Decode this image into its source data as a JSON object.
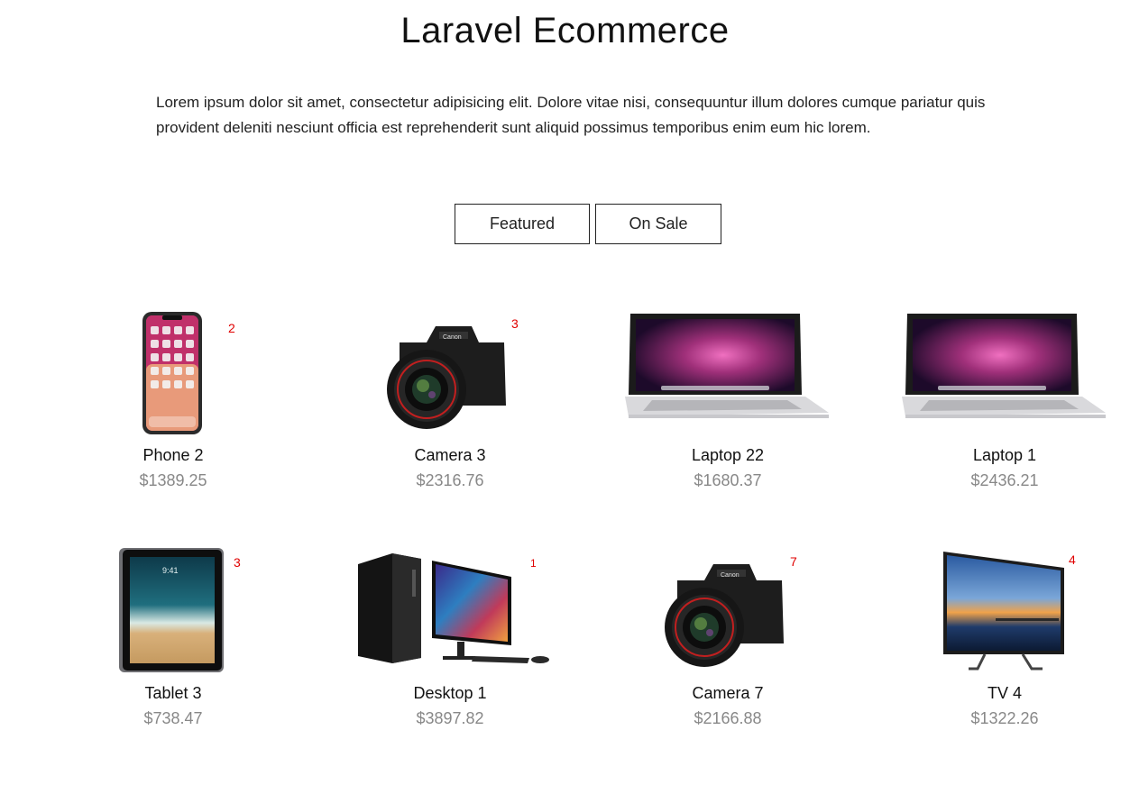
{
  "page": {
    "title": "Laravel Ecommerce",
    "lead": "Lorem ipsum dolor sit amet, consectetur adipisicing elit. Dolore vitae nisi, consequuntur illum dolores cumque pariatur quis provident deleniti nesciunt officia est reprehenderit sunt aliquid possimus temporibus enim eum hic lorem."
  },
  "tabs": {
    "featured": "Featured",
    "on_sale": "On Sale"
  },
  "products": [
    {
      "name": "Phone 2",
      "price": "$1389.25",
      "qty": "2",
      "icon": "phone-image"
    },
    {
      "name": "Camera 3",
      "price": "$2316.76",
      "qty": "3",
      "icon": "camera-image"
    },
    {
      "name": "Laptop 22",
      "price": "$1680.37",
      "qty": "",
      "icon": "laptop-image"
    },
    {
      "name": "Laptop 1",
      "price": "$2436.21",
      "qty": "",
      "icon": "laptop-image"
    },
    {
      "name": "Tablet 3",
      "price": "$738.47",
      "qty": "3",
      "icon": "tablet-image"
    },
    {
      "name": "Desktop 1",
      "price": "$3897.82",
      "qty": "1",
      "icon": "desktop-image"
    },
    {
      "name": "Camera 7",
      "price": "$2166.88",
      "qty": "7",
      "icon": "camera-image"
    },
    {
      "name": "TV 4",
      "price": "$1322.26",
      "qty": "4",
      "icon": "tv-image"
    }
  ],
  "colors": {
    "quantity_badge": "#e00000",
    "price": "#888888"
  }
}
